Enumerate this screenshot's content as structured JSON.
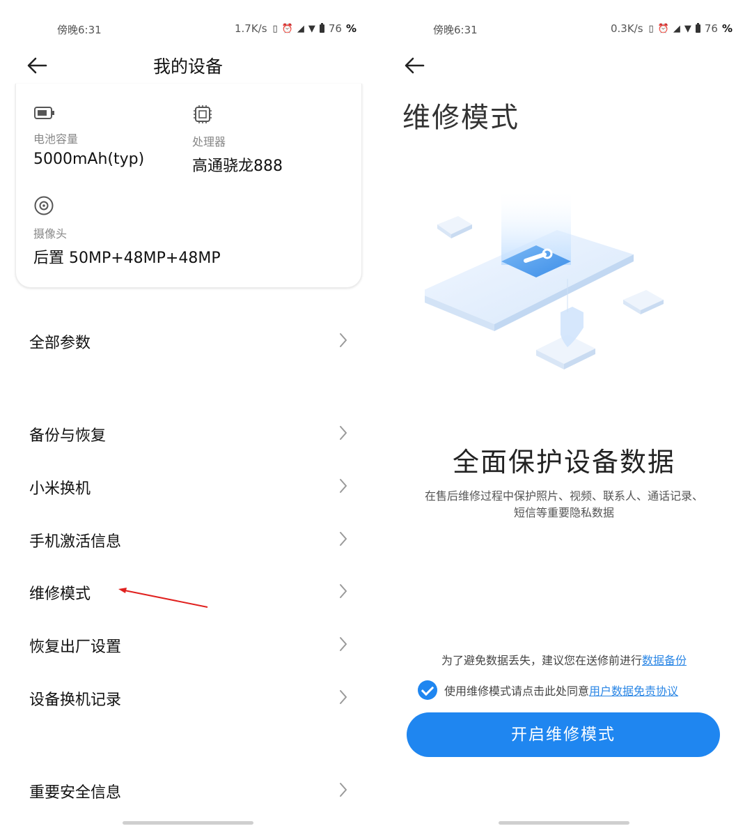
{
  "left": {
    "status": {
      "time": "傍晚6:31",
      "speed": "1.7K/s",
      "battery": "76",
      "pct": "%"
    },
    "title": "我的设备",
    "specs": [
      {
        "icon": "battery-icon",
        "label": "电池容量",
        "value": "5000mAh(typ)"
      },
      {
        "icon": "processor-icon",
        "label": "处理器",
        "value": "高通骁龙888"
      },
      {
        "icon": "camera-icon",
        "label": "摄像头",
        "value": "后置 50MP+48MP+48MP"
      }
    ],
    "menu": [
      "全部参数",
      "备份与恢复",
      "小米换机",
      "手机激活信息",
      "维修模式",
      "恢复出厂设置",
      "设备换机记录",
      "重要安全信息"
    ],
    "annotation_color": "#e0201e"
  },
  "right": {
    "status": {
      "time": "傍晚6:31",
      "speed": "0.3K/s",
      "battery": "76",
      "pct": "%"
    },
    "title": "维修模式",
    "headline": "全面保护设备数据",
    "description_line1": "在售后维修过程中保护照片、视频、联系人、通话记录、",
    "description_line2": "短信等重要隐私数据",
    "note_text": "为了避免数据丢失，建议您在送修前进行",
    "note_link": "数据备份",
    "agree_text": "使用维修模式请点击此处同意",
    "agree_link": "用户数据免责协议",
    "agree_checked": true,
    "button": "开启维修模式",
    "accent_color": "#1f86f0"
  }
}
